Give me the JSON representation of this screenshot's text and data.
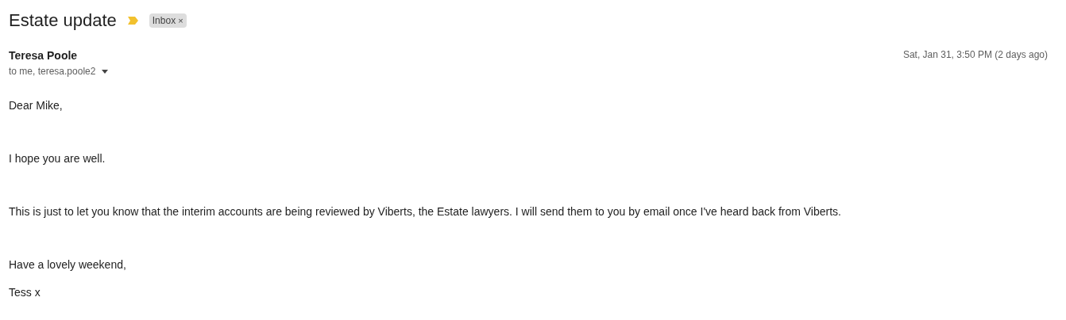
{
  "subject": "Estate update",
  "important": true,
  "labels": [
    {
      "name": "Inbox",
      "remove": "×"
    }
  ],
  "sender": {
    "name": "Teresa Poole",
    "recipients": "to me, teresa.poole2"
  },
  "date": "Sat, Jan 31, 3:50 PM (2 days ago)",
  "body": [
    [
      "Dear Mike,"
    ],
    [
      "I hope you are well."
    ],
    [
      "This is just to let you know that the interim accounts are being reviewed by Viberts, the Estate lawyers. I will send them to you by email once I've heard back from Viberts."
    ],
    [
      "Have a lovely weekend,",
      "Tess x"
    ]
  ]
}
